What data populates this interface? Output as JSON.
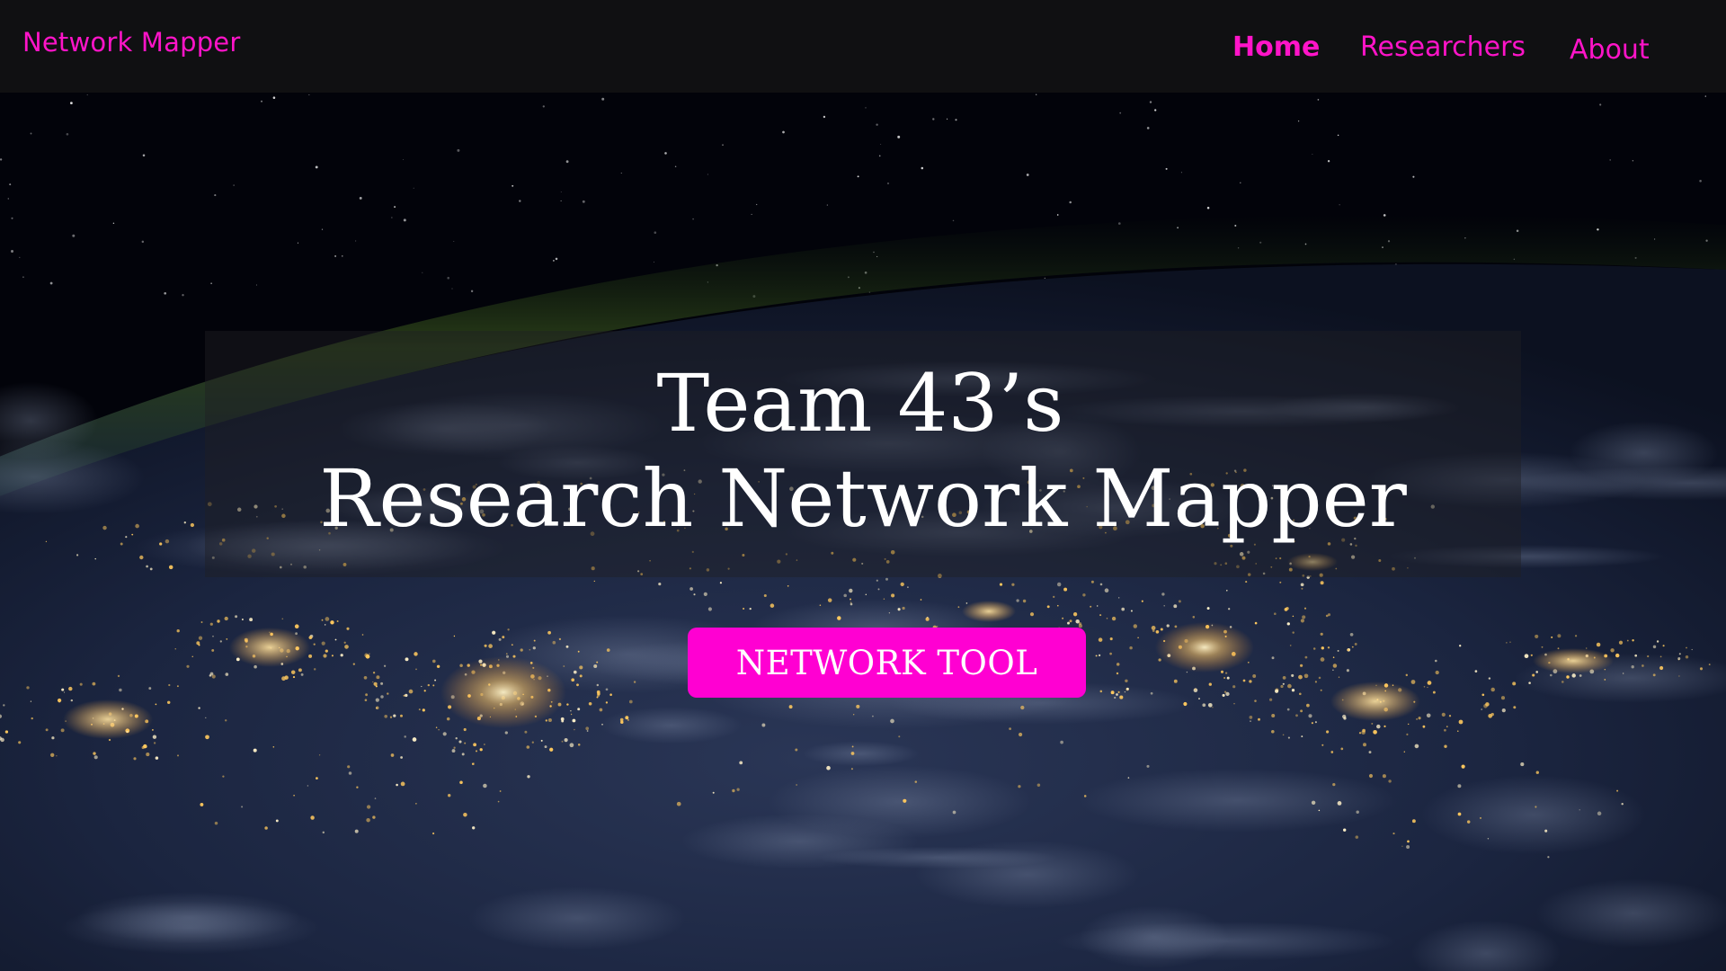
{
  "navbar": {
    "brand": "Network Mapper",
    "links": [
      {
        "label": "Home",
        "active": true
      },
      {
        "label": "Researchers",
        "active": false
      },
      {
        "label": "About",
        "active": false
      }
    ]
  },
  "hero": {
    "title_line1": "Team 43’s",
    "title_line2": "Research Network Mapper",
    "button_label": "NETWORK TOOL"
  },
  "colors": {
    "accent": "#ff14c8",
    "button": "#ff00d2",
    "navbar_bg": "#101012",
    "text": "#ffffff"
  }
}
